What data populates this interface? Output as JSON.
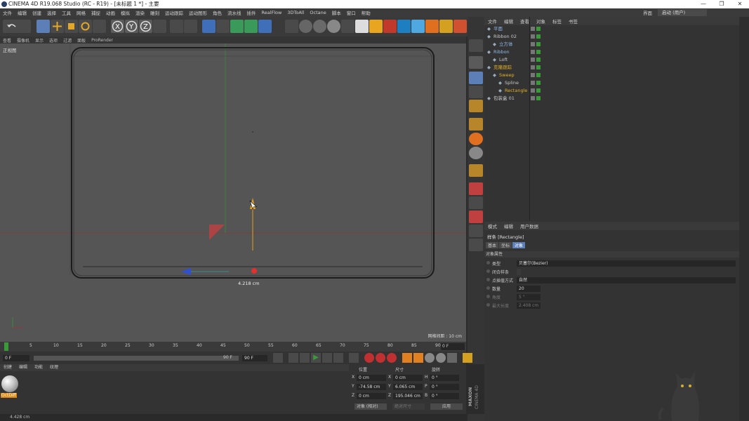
{
  "window": {
    "title": "CINEMA 4D R19.068 Studio (RC - R19) - [未标题 1 *] - 主要"
  },
  "menubar": {
    "items": [
      "文件",
      "编辑",
      "创建",
      "选择",
      "工具",
      "网格",
      "捕捉",
      "动画",
      "模拟",
      "渲染",
      "雕刻",
      "运动跟踪",
      "运动图形",
      "角色",
      "流水线",
      "插件",
      "RealFlow",
      "3DToAll",
      "Octane",
      "脚本",
      "窗口",
      "帮助"
    ],
    "layout_label": "界面",
    "layout_value": "启动 (用户)"
  },
  "viewport_menu": {
    "items": [
      "查看",
      "摄像机",
      "显示",
      "选项",
      "过滤",
      "面板",
      "ProRender"
    ]
  },
  "viewport": {
    "name": "正视图",
    "grid_info": "网格间距 : 10 cm",
    "measure_label": "4.218 cm"
  },
  "objects_panel": {
    "tabs": [
      "文件",
      "编辑",
      "查看",
      "对象",
      "标签",
      "书签"
    ],
    "rows": [
      {
        "name": "平面",
        "indent": 0,
        "color": "#8fb8e8"
      },
      {
        "name": "Ribbon 02",
        "indent": 0,
        "color": "#c8c8c8"
      },
      {
        "name": "立方体",
        "indent": 1,
        "color": "#8fb8e8"
      },
      {
        "name": "Ribbon",
        "indent": 0,
        "color": "#8fb8e8"
      },
      {
        "name": "Loft",
        "indent": 1,
        "color": "#c8c8c8"
      },
      {
        "name": "克隆跟踪",
        "indent": 0,
        "color": "#e0b020"
      },
      {
        "name": "Sweep",
        "indent": 1,
        "color": "#e0b020"
      },
      {
        "name": "Spline",
        "indent": 2,
        "color": "#c8c8c8"
      },
      {
        "name": "Rectangle",
        "indent": 2,
        "color": "#e0b020"
      },
      {
        "name": "包装盒 01",
        "indent": 0,
        "color": "#c8c8c8"
      }
    ]
  },
  "attributes_panel": {
    "tabs": [
      "模式",
      "编辑",
      "用户数据"
    ],
    "object_title": "样条 [Rectangle]",
    "subtabs": [
      "基本",
      "坐标",
      "对象"
    ],
    "section": "对象属性",
    "props": [
      {
        "label": "类型",
        "value": "贝塞尔(Bezier)"
      },
      {
        "label": "闭合样条",
        "value": ""
      },
      {
        "label": "点插值方式",
        "value": "自然"
      },
      {
        "label": "数量",
        "value": "20"
      },
      {
        "label": "角度",
        "value": "5 °"
      },
      {
        "label": "最大长度",
        "value": "2.408 cm"
      }
    ]
  },
  "timeline": {
    "ticks": [
      "0",
      "5",
      "10",
      "15",
      "20",
      "25",
      "30",
      "35",
      "40",
      "45",
      "50",
      "55",
      "60",
      "65",
      "70",
      "75",
      "80",
      "85",
      "90"
    ],
    "frame_right": "0 F"
  },
  "transport": {
    "start": "0 F",
    "slider_end": "90 F",
    "end": "90 F"
  },
  "material_panel": {
    "tabs": [
      "创建",
      "编辑",
      "功能",
      "纹理"
    ],
    "material_name": "OctDiff"
  },
  "coord_panel": {
    "headers": [
      "位置",
      "尺寸",
      "旋转"
    ],
    "pos": [
      {
        "axis": "X",
        "value": "0 cm"
      },
      {
        "axis": "Y",
        "value": "-74.58 cm"
      },
      {
        "axis": "Z",
        "value": "0 cm"
      }
    ],
    "size": [
      {
        "axis": "X",
        "value": "0 cm"
      },
      {
        "axis": "Y",
        "value": "6.065 cm"
      },
      {
        "axis": "Z",
        "value": "195.046 cm"
      }
    ],
    "rot": [
      {
        "axis": "H",
        "value": "0 °"
      },
      {
        "axis": "P",
        "value": "0 °"
      },
      {
        "axis": "B",
        "value": "0 °"
      }
    ],
    "mode_select": "对象 (相对)",
    "size_select": "绝对尺寸",
    "apply": "应用"
  },
  "brand": {
    "maxon": "MAXON",
    "product": "CINEMA 4D"
  },
  "status": {
    "text": "4.428 cm"
  }
}
